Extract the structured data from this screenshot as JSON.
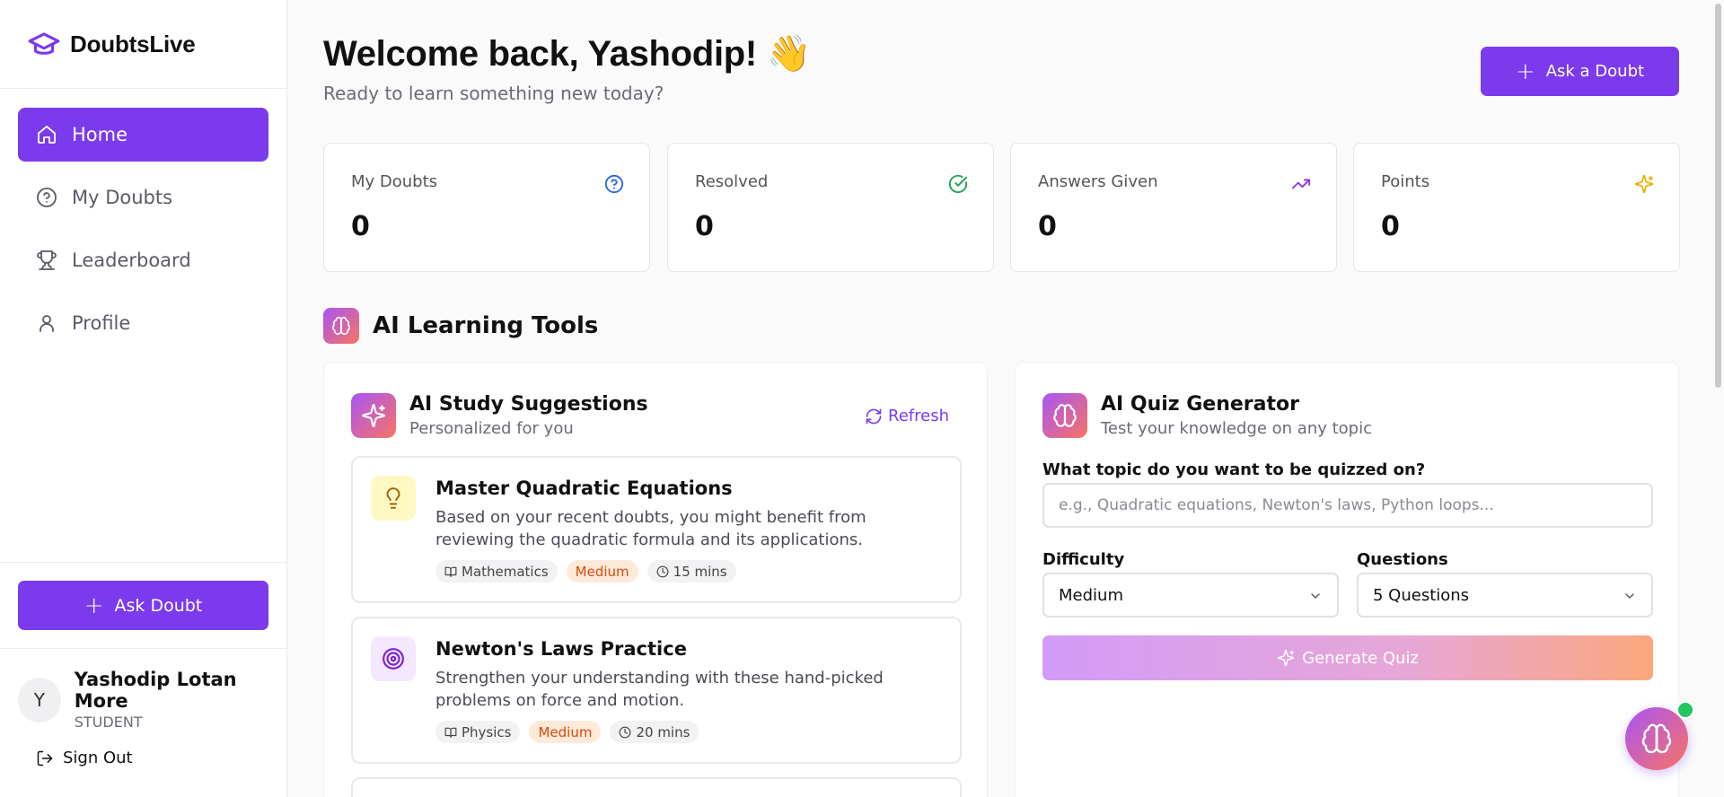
{
  "app": {
    "name": "DoubtsLive",
    "brand_color": "#7c3aed"
  },
  "sidebar": {
    "items": [
      {
        "label": "Home",
        "icon": "home-icon",
        "active": true
      },
      {
        "label": "My Doubts",
        "icon": "help-circle-icon",
        "active": false
      },
      {
        "label": "Leaderboard",
        "icon": "trophy-icon",
        "active": false
      },
      {
        "label": "Profile",
        "icon": "user-icon",
        "active": false
      }
    ],
    "ask_label": "Ask Doubt",
    "user": {
      "initial": "Y",
      "name": "Yashodip Lotan More",
      "role": "STUDENT"
    },
    "signout_label": "Sign Out"
  },
  "header": {
    "welcome": "Welcome back, Yashodip! 👋",
    "subtitle": "Ready to learn something new today?",
    "ask_label": "Ask a Doubt"
  },
  "stats": [
    {
      "label": "My Doubts",
      "value": "0",
      "icon": "help-circle-icon",
      "color": "#2563eb"
    },
    {
      "label": "Resolved",
      "value": "0",
      "icon": "check-circle-icon",
      "color": "#16a34a"
    },
    {
      "label": "Answers Given",
      "value": "0",
      "icon": "trending-up-icon",
      "color": "#9333ea"
    },
    {
      "label": "Points",
      "value": "0",
      "icon": "sparkles-icon",
      "color": "#eab308"
    }
  ],
  "ai_tools": {
    "title": "AI Learning Tools",
    "suggestions": {
      "title": "AI Study Suggestions",
      "subtitle": "Personalized for you",
      "refresh_label": "Refresh",
      "items": [
        {
          "title": "Master Quadratic Equations",
          "description": "Based on your recent doubts, you might benefit from reviewing the quadratic formula and its applications.",
          "subject": "Mathematics",
          "difficulty": "Medium",
          "duration": "15 mins",
          "icon": "lightbulb-icon"
        },
        {
          "title": "Newton's Laws Practice",
          "description": "Strengthen your understanding with these hand-picked problems on force and motion.",
          "subject": "Physics",
          "difficulty": "Medium",
          "duration": "20 mins",
          "icon": "target-icon"
        }
      ]
    },
    "quiz": {
      "title": "AI Quiz Generator",
      "subtitle": "Test your knowledge on any topic",
      "topic_label": "What topic do you want to be quizzed on?",
      "topic_placeholder": "e.g., Quadratic equations, Newton's laws, Python loops...",
      "topic_value": "",
      "difficulty_label": "Difficulty",
      "difficulty_value": "Medium",
      "questions_label": "Questions",
      "questions_value": "5 Questions",
      "generate_label": "Generate Quiz"
    }
  }
}
